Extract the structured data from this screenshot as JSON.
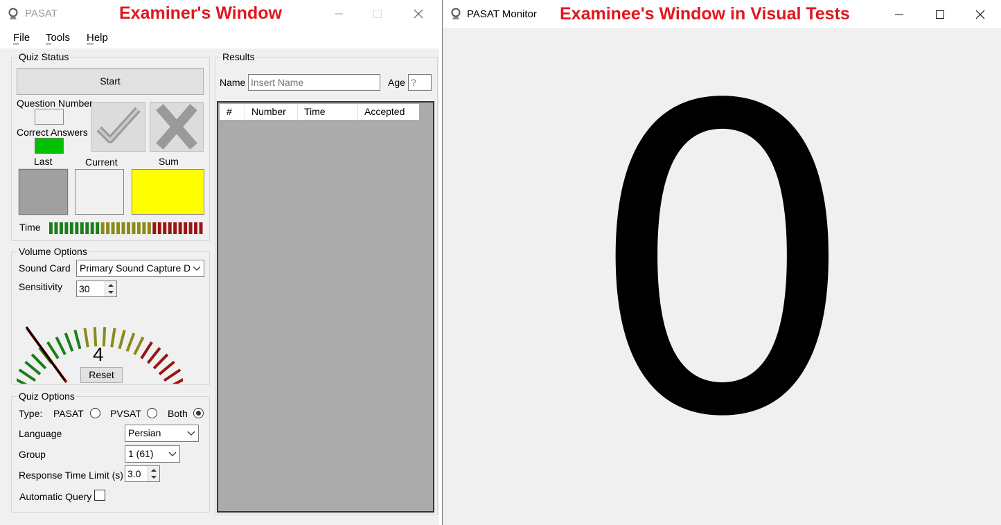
{
  "examiner": {
    "app_title": "PASAT",
    "heading": "Examiner's Window",
    "menu": [
      "File",
      "Tools",
      "Help"
    ],
    "quiz_status": {
      "group_label": "Quiz Status",
      "start_label": "Start",
      "question_number_label": "Question Number",
      "correct_answers_label": "Correct Answers",
      "last_label": "Last",
      "current_label": "Current",
      "sum_label": "Sum",
      "time_label": "Time",
      "colors": {
        "correct_answers_box": "#00c000",
        "last_box": "#a0a0a0",
        "sum_box": "#ffff00"
      }
    },
    "volume_options": {
      "group_label": "Volume Options",
      "sound_card_label": "Sound Card",
      "sound_card_value": "Primary Sound Capture Dri",
      "sensitivity_label": "Sensitivity",
      "sensitivity_value": "30",
      "meter_value": "4",
      "reset_label": "Reset"
    },
    "quiz_options": {
      "group_label": "Quiz Options",
      "type_label": "Type:",
      "type_options": [
        "PASAT",
        "PVSAT",
        "Both"
      ],
      "type_selected": "Both",
      "language_label": "Language",
      "language_value": "Persian",
      "group_field_label": "Group",
      "group_value": "1 (61)",
      "response_time_label": "Response Time Limit (s)",
      "response_time_value": "3.0",
      "automatic_query_label": "Automatic Query",
      "automatic_query_checked": false
    },
    "results": {
      "group_label": "Results",
      "name_label": "Name",
      "name_placeholder": "Insert Name",
      "age_label": "Age",
      "age_placeholder": "?",
      "columns": [
        "#",
        "Number",
        "Time",
        "Accepted"
      ],
      "rows": []
    }
  },
  "monitor": {
    "app_title": "PASAT Monitor",
    "heading": "Examinee's Window in Visual Tests",
    "digit": "0"
  }
}
